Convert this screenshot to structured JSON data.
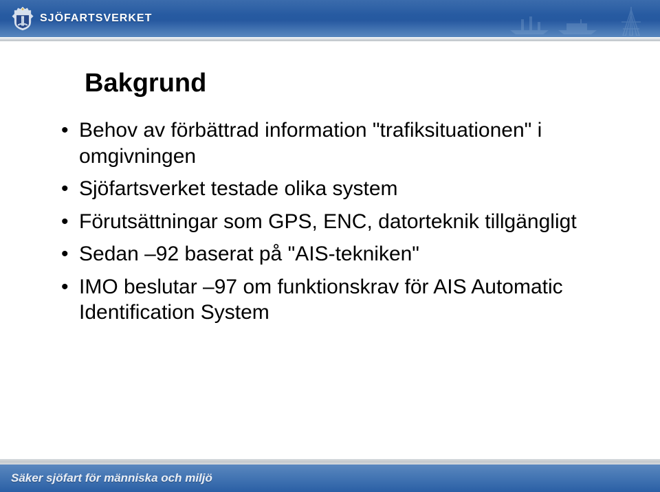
{
  "brand": {
    "wordmark": "SJÖFARTSVERKET"
  },
  "title": "Bakgrund",
  "bullets": [
    "Behov av förbättrad information \"trafiksituationen\" i omgivningen",
    "Sjöfartsverket testade olika system",
    "Förutsättningar som GPS, ENC, datorteknik tillgängligt",
    "Sedan –92 baserat på \"AIS-tekniken\"",
    "IMO beslutar –97 om funktionskrav för AIS Automatic Identification System"
  ],
  "footer": {
    "tagline": "Säker sjöfart för människa och miljö"
  }
}
